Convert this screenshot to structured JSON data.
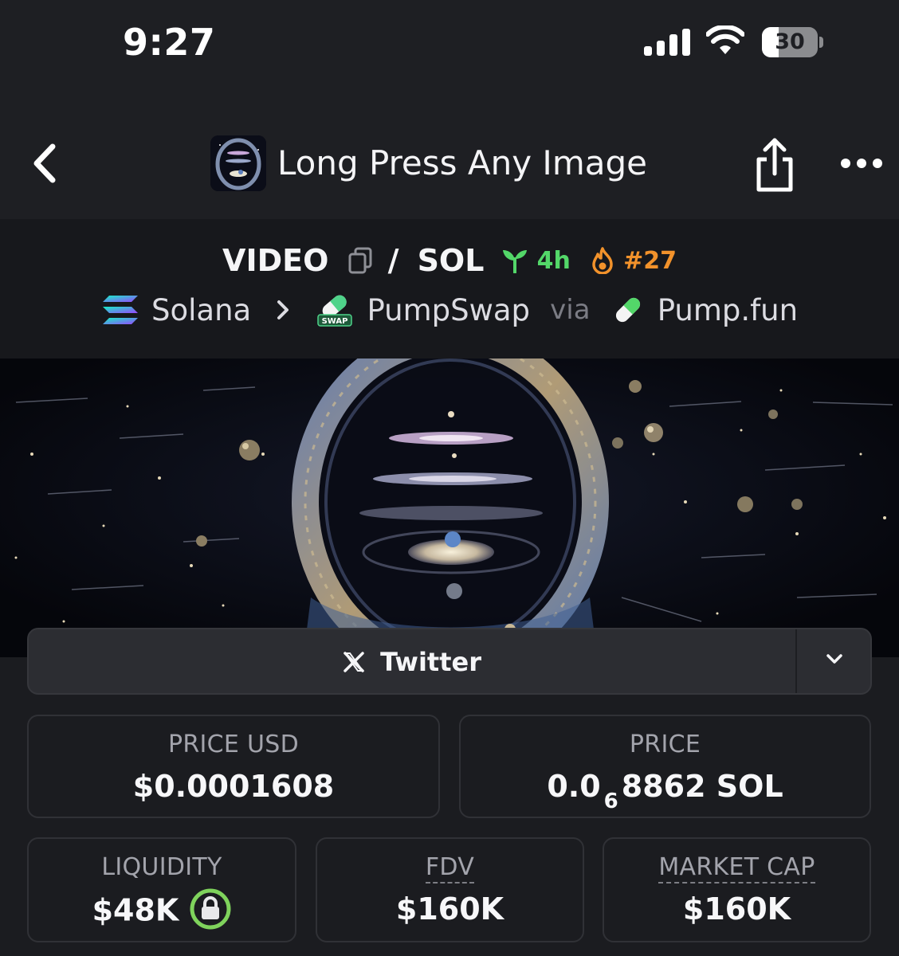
{
  "status_bar": {
    "time": "9:27",
    "battery_level": "30",
    "battery_fraction": 0.3
  },
  "nav": {
    "title": "Long Press Any Image"
  },
  "pair": {
    "base": "VIDEO",
    "slash": "/",
    "quote": "SOL",
    "age": "4h",
    "rank": "#27",
    "age_color": "#53d769",
    "rank_color": "#f2922b"
  },
  "chain_path": {
    "chain": "Solana",
    "dex": "PumpSwap",
    "swap_badge": "SWAP",
    "via": "via",
    "launchpad": "Pump.fun"
  },
  "social": {
    "label": "Twitter"
  },
  "stats": {
    "price_usd": {
      "label": "PRICE USD",
      "value": "$0.0001608"
    },
    "price": {
      "label": "PRICE",
      "prefix": "0.0",
      "zeros": "6",
      "digits": "8862",
      "unit": "SOL"
    },
    "liquidity": {
      "label": "LIQUIDITY",
      "value": "$48K"
    },
    "fdv": {
      "label": "FDV",
      "value": "$160K"
    },
    "market_cap": {
      "label": "MARKET CAP",
      "value": "$160K"
    }
  },
  "icons": {
    "back": "chevron-left-icon",
    "share": "share-icon",
    "more": "ellipsis-icon",
    "copy": "copy-icon",
    "age": "sprout-icon",
    "rank": "fire-icon",
    "chain": "solana-icon",
    "dex": "pumpswap-icon",
    "launchpad": "pill-icon",
    "social": "x-icon",
    "dropdown": "chevron-down-icon",
    "liquidity": "lock-icon"
  }
}
